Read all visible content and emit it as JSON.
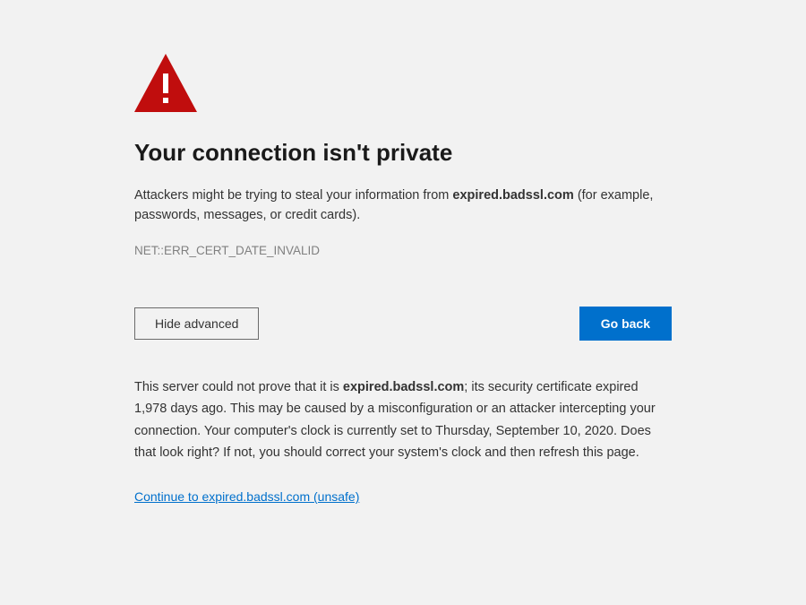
{
  "icon_color": "#c00d0d",
  "heading": "Your connection isn't private",
  "description_prefix": "Attackers might be trying to steal your information from ",
  "hostname": "expired.badssl.com",
  "description_suffix": " (for example, passwords, messages, or credit cards).",
  "error_code": "NET::ERR_CERT_DATE_INVALID",
  "buttons": {
    "advanced_label": "Hide advanced",
    "goback_label": "Go back"
  },
  "details_prefix": "This server could not prove that it is ",
  "details_suffix": "; its security certificate expired 1,978 days ago. This may be caused by a misconfiguration or an attacker intercepting your connection. Your computer's clock is currently set to Thursday, September 10, 2020. Does that look right? If not, you should correct your system's clock and then refresh this page.",
  "continue_link_text": "Continue to expired.badssl.com (unsafe)"
}
